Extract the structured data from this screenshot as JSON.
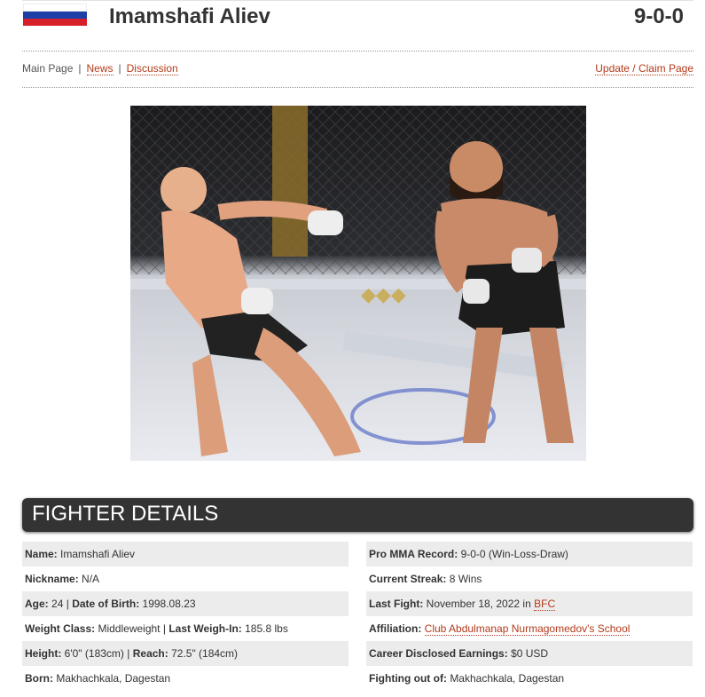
{
  "header": {
    "fighter_name": "Imamshafi Aliev",
    "record": "9-0-0",
    "flag": {
      "country_colors": [
        "#ffffff",
        "#1c3fa8",
        "#d5202a"
      ]
    }
  },
  "nav": {
    "main_page": "Main Page",
    "sep": "|",
    "news": "News",
    "discussion": "Discussion",
    "claim": "Update / Claim Page"
  },
  "photo": {
    "alt": "fighter-photo"
  },
  "section": {
    "title": "FIGHTER DETAILS"
  },
  "details": {
    "name_label": "Name:",
    "name_value": "Imamshafi Aliev",
    "nickname_label": "Nickname:",
    "nickname_value": "N/A",
    "age_label": "Age:",
    "age_value": "24",
    "dob_sep": "|",
    "dob_label": "Date of Birth:",
    "dob_value": "1998.08.23",
    "weight_class_label": "Weight Class:",
    "weight_class_value": "Middleweight",
    "weighin_label": "Last Weigh-In:",
    "weighin_value": "185.8 lbs",
    "height_label": "Height:",
    "height_value": "6'0\" (183cm)",
    "reach_label": "Reach:",
    "reach_value": "72.5\" (184cm)",
    "born_label": "Born:",
    "born_value": "Makhachkala, Dagestan",
    "record_label": "Pro MMA Record:",
    "record_value": "9-0-0 (Win-Loss-Draw)",
    "streak_label": "Current Streak:",
    "streak_value": "8 Wins",
    "last_fight_label": "Last Fight:",
    "last_fight_value": "November 18, 2022",
    "in_word": "in",
    "last_fight_org": "BFC",
    "affiliation_label": "Affiliation:",
    "affiliation_value": "Club Abdulmanap Nurmagomedov's School",
    "earnings_label": "Career Disclosed Earnings:",
    "earnings_value": "$0 USD",
    "fighting_out_label": "Fighting out of:",
    "fighting_out_value": "Makhachkala, Dagestan"
  },
  "colors": {
    "accent_link": "#b33a1a",
    "section_bar": "#333333",
    "row_alt": "#ececec"
  }
}
